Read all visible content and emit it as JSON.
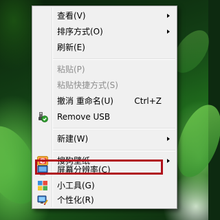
{
  "context_menu": {
    "items": [
      {
        "label": "查看(V)",
        "submenu": true
      },
      {
        "label": "排序方式(O)",
        "submenu": true
      },
      {
        "label": "刷新(E)"
      },
      {
        "label": "粘贴(P)",
        "disabled": true
      },
      {
        "label": "粘贴快捷方式(S)",
        "disabled": true
      },
      {
        "label": "撤消 重命名(U)",
        "shortcut": "Ctrl+Z"
      },
      {
        "label": "Remove USB",
        "icon": "usb-shield-icon"
      },
      {
        "label": "新建(W)",
        "submenu": true
      },
      {
        "label": "搜狗壁纸",
        "icon": "sogou-wallpaper-icon",
        "submenu": true
      },
      {
        "label": "屏幕分辨率(C)",
        "icon": "screen-resolution-icon",
        "highlighted": true
      },
      {
        "label": "小工具(G)",
        "icon": "gadgets-icon"
      },
      {
        "label": "个性化(R)",
        "icon": "personalize-icon"
      }
    ]
  },
  "colors": {
    "menu_background": "#f0f0f0",
    "highlight_border": "#b0101a",
    "disabled_text": "#8d8d8d"
  }
}
